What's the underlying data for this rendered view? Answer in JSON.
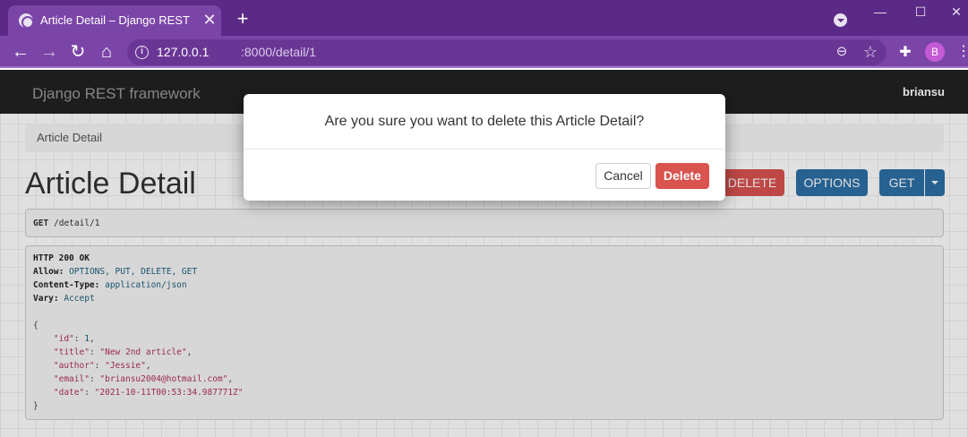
{
  "browser": {
    "tab_title": "Article Detail – Django REST framework",
    "tab_close": "✕",
    "new_tab": "+",
    "url_host": "127.0.0.1",
    "url_path": ":8000/detail/1",
    "avatar_letter": "B",
    "window_minimize": "—",
    "window_maximize": "☐",
    "window_close": "✕"
  },
  "navbar": {
    "brand": "Django REST framework",
    "user": "briansu"
  },
  "breadcrumb": "Article Detail",
  "page_title": "Article Detail",
  "buttons": {
    "delete": "DELETE",
    "options": "OPTIONS",
    "get": "GET"
  },
  "request": {
    "method": "GET",
    "path": "/detail/1"
  },
  "response": {
    "status": "HTTP 200 OK",
    "headers": [
      {
        "key": "Allow:",
        "value": "OPTIONS, PUT, DELETE, GET"
      },
      {
        "key": "Content-Type:",
        "value": "application/json"
      },
      {
        "key": "Vary:",
        "value": "Accept"
      }
    ],
    "open_brace": "{",
    "close_brace": "}",
    "fields": [
      {
        "key": "\"id\"",
        "value": "1",
        "type": "number"
      },
      {
        "key": "\"title\"",
        "value": "\"New 2nd article\"",
        "type": "string"
      },
      {
        "key": "\"author\"",
        "value": "\"Jessie\"",
        "type": "string"
      },
      {
        "key": "\"email\"",
        "value": "\"briansu2004@hotmail.com\"",
        "type": "string"
      },
      {
        "key": "\"date\"",
        "value": "\"2021-10-11T00:53:34.987771Z\"",
        "type": "string"
      }
    ]
  },
  "modal": {
    "message": "Are you sure you want to delete this Article Detail?",
    "cancel": "Cancel",
    "delete": "Delete"
  },
  "colors": {
    "chrome_purple": "#5b2a86",
    "danger": "#d9534f",
    "primary": "#2c6fa6",
    "navbar": "#222222"
  }
}
